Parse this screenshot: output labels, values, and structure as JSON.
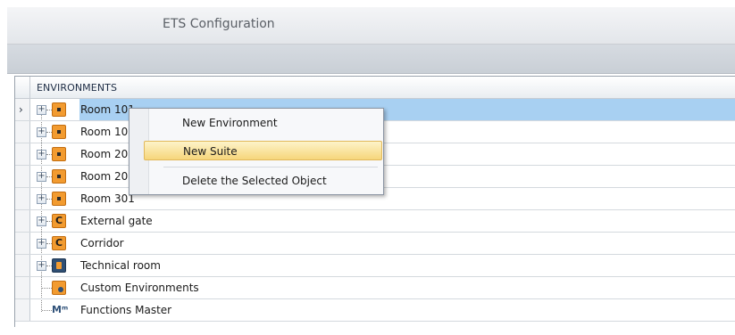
{
  "window": {
    "title": "ETS Configuration"
  },
  "grid": {
    "column_header": "ENVIRONMENTS",
    "rows": [
      {
        "label": "Room 101",
        "icon": "room-icon",
        "selected": true,
        "expandable": true
      },
      {
        "label": "Room 102",
        "icon": "room-icon",
        "selected": false,
        "expandable": true
      },
      {
        "label": "Room 201",
        "icon": "room-icon",
        "selected": false,
        "expandable": true
      },
      {
        "label": "Room 202",
        "icon": "room-icon",
        "selected": false,
        "expandable": true
      },
      {
        "label": "Room 301",
        "icon": "room-icon",
        "selected": false,
        "expandable": true
      },
      {
        "label": "External gate",
        "icon": "corridor-icon",
        "selected": false,
        "expandable": true
      },
      {
        "label": "Corridor",
        "icon": "corridor-icon",
        "selected": false,
        "expandable": true
      },
      {
        "label": "Technical room",
        "icon": "technical-room-icon",
        "selected": false,
        "expandable": true
      },
      {
        "label": "Custom Environments",
        "icon": "custom-environment-icon",
        "selected": false,
        "expandable": false
      },
      {
        "label": "Functions Master",
        "icon": "functions-master-icon",
        "selected": false,
        "expandable": false
      }
    ]
  },
  "context_menu": {
    "items": [
      {
        "label": "New Environment",
        "highlighted": false
      },
      {
        "label": "New Suite",
        "highlighted": true
      },
      {
        "label": "Delete the Selected Object",
        "highlighted": false
      }
    ]
  },
  "colors": {
    "selection": "#a8d0f2",
    "menu_highlight": "#f6d67b",
    "icon_orange": "#f29b30"
  }
}
